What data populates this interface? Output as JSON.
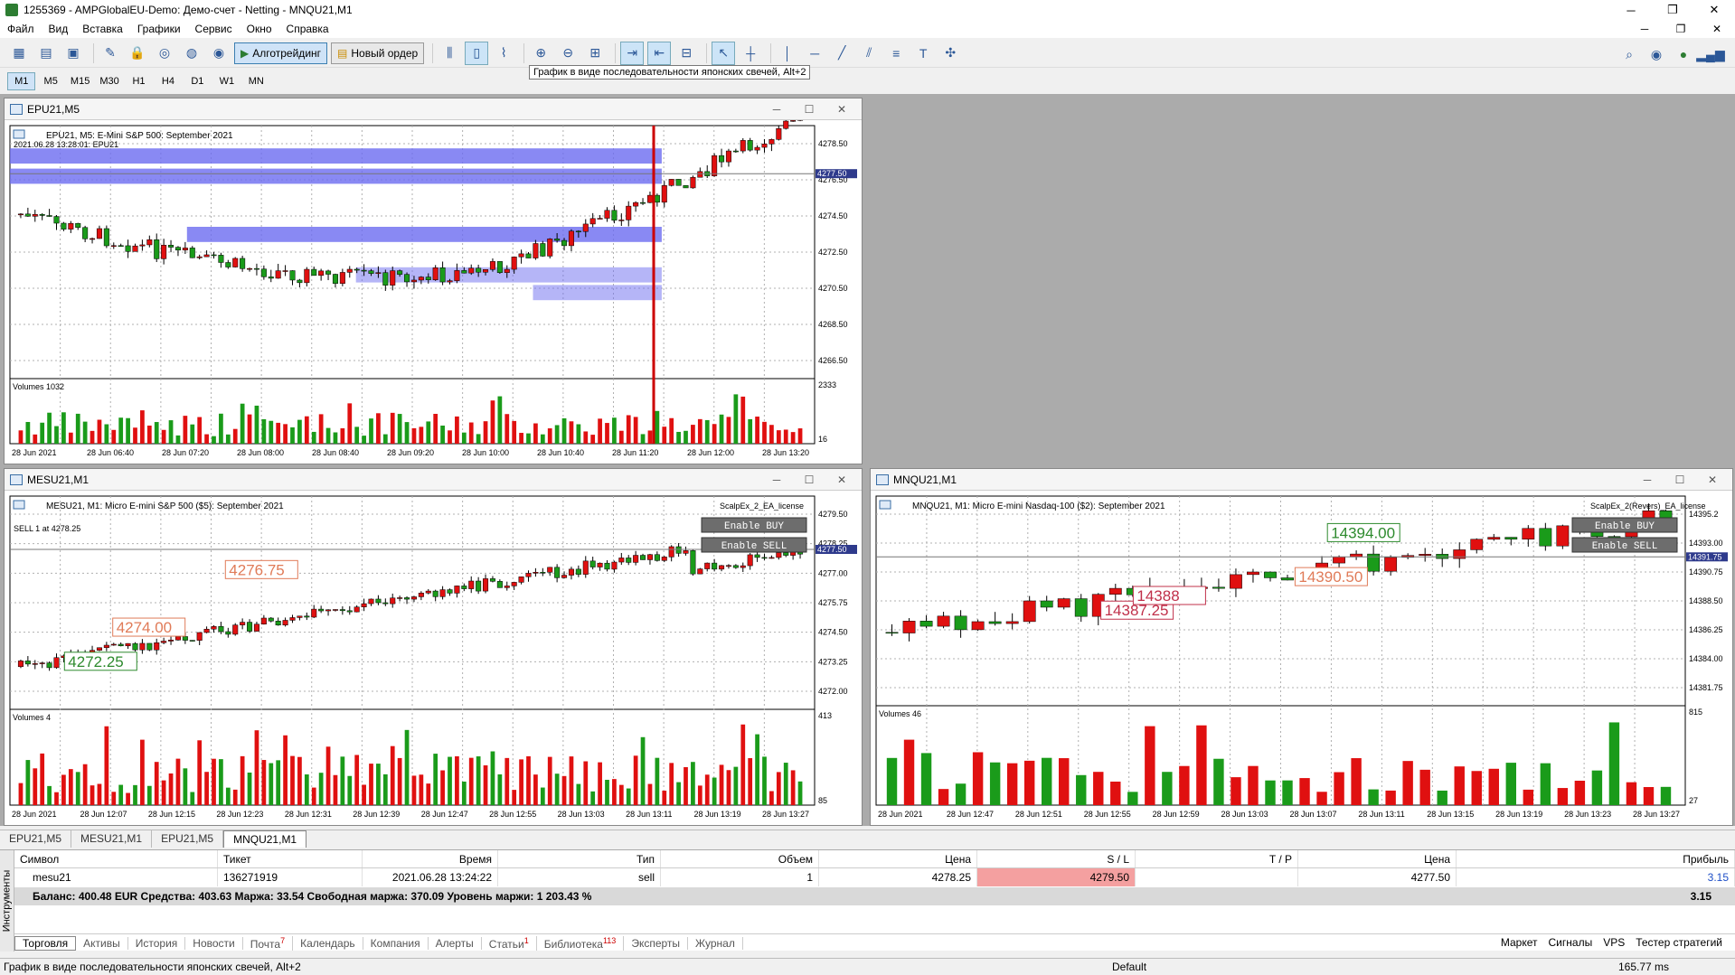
{
  "window": {
    "title": "1255369 - AMPGlobalEU-Demo: Демо-счет - Netting - MNQU21,M1"
  },
  "menu": [
    "Файл",
    "Вид",
    "Вставка",
    "Графики",
    "Сервис",
    "Окно",
    "Справка"
  ],
  "toolbar": {
    "algo_label": "Алготрейдинг",
    "order_label": "Новый ордер",
    "tooltip": "График в виде последовательности японских свечей, Alt+2"
  },
  "timeframes": [
    "M1",
    "M5",
    "M15",
    "M30",
    "H1",
    "H4",
    "D1",
    "W1",
    "MN"
  ],
  "charts": [
    {
      "id": "epu",
      "caption": "EPU21,M5",
      "info": "EPU21, M5: E-Mini S&P 500: September 2021",
      "sub": "2021.06.28 13:28:01: EPU21",
      "volumes": "Volumes 1032",
      "yticks": [
        "4278.50",
        "4276.50",
        "4274.50",
        "4272.50",
        "4270.50",
        "4268.50",
        "4266.50"
      ],
      "price": "4277.50",
      "vticks": [
        "2333",
        "16"
      ],
      "xticks": [
        "28 Jun 2021",
        "28 Jun 06:40",
        "28 Jun 07:20",
        "28 Jun 08:00",
        "28 Jun 08:40",
        "28 Jun 09:20",
        "28 Jun 10:00",
        "28 Jun 10:40",
        "28 Jun 11:20",
        "28 Jun 12:00",
        "28 Jun 13:20"
      ]
    },
    {
      "id": "mesu",
      "caption": "MESU21,M1",
      "info": "MESU21, M1: Micro E-mini S&P 500 ($5): September 2021",
      "sub": "SELL 1 at 4278.25",
      "volumes": "Volumes 4",
      "ea": "ScalpEx_2_EA_license",
      "yticks": [
        "4279.50",
        "4278.25",
        "4277.00",
        "4275.75",
        "4274.50",
        "4273.25",
        "4272.00"
      ],
      "price": "4277.50",
      "vticks": [
        "413",
        "85"
      ],
      "xticks": [
        "28 Jun 2021",
        "28 Jun 12:07",
        "28 Jun 12:15",
        "28 Jun 12:23",
        "28 Jun 12:31",
        "28 Jun 12:39",
        "28 Jun 12:47",
        "28 Jun 12:55",
        "28 Jun 13:03",
        "28 Jun 13:11",
        "28 Jun 13:19",
        "28 Jun 13:27"
      ],
      "labels": [
        "4276.75",
        "4274.00",
        "4272.25"
      ]
    },
    {
      "id": "mnqu",
      "caption": "MNQU21,M1",
      "info": "MNQU21, M1: Micro E-mini Nasdaq-100 ($2): September 2021",
      "volumes": "Volumes 46",
      "ea": "ScalpEx_2(Revers)_EA_license",
      "yticks": [
        "14395.2",
        "14393.00",
        "14390.75",
        "14388.50",
        "14386.25",
        "14384.00",
        "14381.75"
      ],
      "price": "14391.75",
      "vticks": [
        "815",
        "27"
      ],
      "xticks": [
        "28 Jun 2021",
        "28 Jun 12:47",
        "28 Jun 12:51",
        "28 Jun 12:55",
        "28 Jun 12:59",
        "28 Jun 13:03",
        "28 Jun 13:07",
        "28 Jun 13:11",
        "28 Jun 13:15",
        "28 Jun 13:19",
        "28 Jun 13:23",
        "28 Jun 13:27"
      ],
      "labels": [
        "14394.00",
        "14390.50",
        "14387.25",
        "14388"
      ]
    }
  ],
  "ea_buttons": {
    "buy": "Enable BUY",
    "sell": "Enable SELL"
  },
  "chart_tabs": [
    "EPU21,M5",
    "MESU21,M1",
    "EPU21,M5",
    "MNQU21,M1"
  ],
  "terminal": {
    "side_label": "Инструменты",
    "headers": [
      "Символ",
      "Тикет",
      "Время",
      "Тип",
      "Объем",
      "Цена",
      "S / L",
      "T / P",
      "Цена",
      "Прибыль"
    ],
    "row": [
      "mesu21",
      "136271919",
      "2021.06.28 13:24:22",
      "sell",
      "1",
      "4278.25",
      "4279.50",
      "",
      "4277.50",
      "3.15"
    ],
    "balance": "Баланс: 400.48 EUR  Средства: 403.63  Маржа: 33.54  Свободная маржа: 370.09  Уровень маржи: 1 203.43 %",
    "balance_value": "3.15",
    "tabs": [
      {
        "t": "Торговля"
      },
      {
        "t": "Активы"
      },
      {
        "t": "История"
      },
      {
        "t": "Новости"
      },
      {
        "t": "Почта",
        "n": "7"
      },
      {
        "t": "Календарь"
      },
      {
        "t": "Компания"
      },
      {
        "t": "Алерты"
      },
      {
        "t": "Статьи",
        "n": "1"
      },
      {
        "t": "Библиотека",
        "n": "113"
      },
      {
        "t": "Эксперты"
      },
      {
        "t": "Журнал"
      }
    ],
    "right_tabs": [
      "Маркет",
      "Сигналы",
      "VPS",
      "Тестер стратегий"
    ]
  },
  "status": {
    "left": "График в виде последовательности японских свечей, Alt+2",
    "profile": "Default",
    "ping": "165.77 ms"
  },
  "colors": {
    "bull": "#1a9b1a",
    "bear": "#e01010",
    "zone": "#6b6bf0",
    "grid": "#b0b0b0"
  }
}
